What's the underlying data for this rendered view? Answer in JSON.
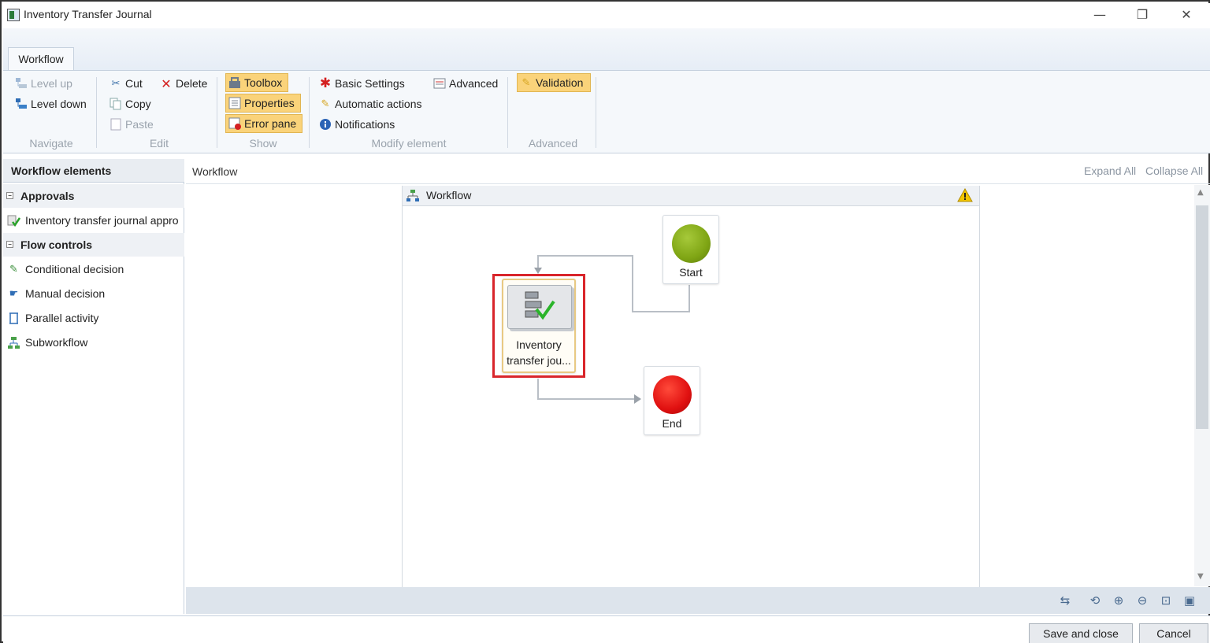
{
  "window": {
    "title": "Inventory Transfer Journal",
    "minimize": "—",
    "restore": "❐",
    "close": "✕"
  },
  "tabs": [
    {
      "label": "Workflow"
    }
  ],
  "ribbon": {
    "navigate": {
      "label": "Navigate",
      "level_up": "Level up",
      "level_down": "Level down"
    },
    "edit": {
      "label": "Edit",
      "cut": "Cut",
      "copy": "Copy",
      "paste": "Paste",
      "delete": "Delete"
    },
    "show": {
      "label": "Show",
      "toolbox": "Toolbox",
      "properties": "Properties",
      "error_pane": "Error pane"
    },
    "modify": {
      "label": "Modify element",
      "basic_settings": "Basic Settings",
      "automatic_actions": "Automatic actions",
      "notifications": "Notifications",
      "advanced": "Advanced"
    },
    "advanced": {
      "label": "Advanced",
      "validation": "Validation"
    }
  },
  "left_panel": {
    "header": "Workflow elements",
    "groups": [
      {
        "label": "Approvals",
        "items": [
          "Inventory transfer journal appro"
        ]
      },
      {
        "label": "Flow controls",
        "items": [
          "Conditional decision",
          "Manual decision",
          "Parallel activity",
          "Subworkflow"
        ]
      }
    ]
  },
  "main": {
    "title": "Workflow",
    "expand_all": "Expand All",
    "collapse_all": "Collapse All",
    "workflow_title": "Workflow"
  },
  "nodes": {
    "start": "Start",
    "end": "End",
    "approval_line1": "Inventory",
    "approval_line2": "transfer jou..."
  },
  "colors": {
    "start": "#7fa514",
    "end": "#e01010",
    "selection": "#d9252b",
    "active_button": "#fad37a"
  },
  "footer": {
    "save_and_close": "Save and close",
    "cancel": "Cancel"
  }
}
